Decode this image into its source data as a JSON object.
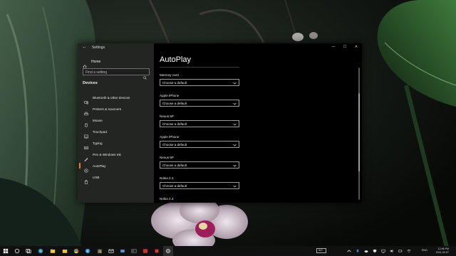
{
  "window": {
    "app_title": "Settings",
    "home_label": "Home",
    "search_placeholder": "Find a setting",
    "section": "Devices",
    "nav": [
      {
        "label": "Bluetooth & other devices",
        "icon": "bluetooth-icon"
      },
      {
        "label": "Printers & scanners",
        "icon": "printer-icon"
      },
      {
        "label": "Mouse",
        "icon": "mouse-icon"
      },
      {
        "label": "Touchpad",
        "icon": "touchpad-icon"
      },
      {
        "label": "Typing",
        "icon": "keyboard-icon"
      },
      {
        "label": "Pen & Windows Ink",
        "icon": "pen-icon"
      },
      {
        "label": "AutoPlay",
        "icon": "autoplay-icon",
        "active": true
      },
      {
        "label": "USB",
        "icon": "usb-icon"
      }
    ],
    "controls": {
      "minimize": "—",
      "maximize": "☐",
      "close": "✕"
    }
  },
  "content": {
    "title": "AutoPlay",
    "options": [
      {
        "label": "Memory card",
        "value": "Choose a default"
      },
      {
        "label": "Apple iPhone",
        "value": "Choose a default"
      },
      {
        "label": "Nexus 6P",
        "value": "Choose a default"
      },
      {
        "label": "Apple iPhone",
        "value": "Choose a default"
      },
      {
        "label": "Nexus 6P",
        "value": "Choose a default"
      },
      {
        "label": "Nokia 2.3",
        "value": "Choose a default"
      },
      {
        "label": "Nokia 2.3",
        "value": null
      }
    ]
  },
  "taskbar": {
    "action_center": "A/C",
    "language": "ENG",
    "time": "12:46 PM",
    "date": "2021-02-07"
  },
  "colors": {
    "accent": "#e37f20",
    "window_bg": "#000000",
    "sidebar_bg": "#262826",
    "taskbar_bg": "#101010"
  }
}
